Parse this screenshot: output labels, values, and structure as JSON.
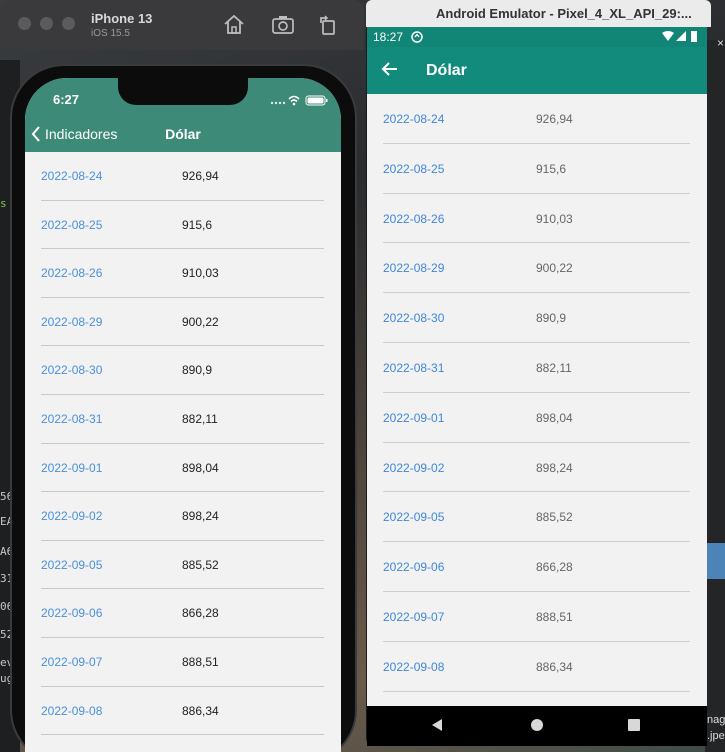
{
  "ios": {
    "device_name": "iPhone 13",
    "os_version": "iOS 15.5",
    "time": "6:27",
    "back_label": "Indicadores",
    "title": "Dólar",
    "rows": [
      {
        "date": "2022-08-24",
        "value": "926,94"
      },
      {
        "date": "2022-08-25",
        "value": "915,6"
      },
      {
        "date": "2022-08-26",
        "value": "910,03"
      },
      {
        "date": "2022-08-29",
        "value": "900,22"
      },
      {
        "date": "2022-08-30",
        "value": "890,9"
      },
      {
        "date": "2022-08-31",
        "value": "882,11"
      },
      {
        "date": "2022-09-01",
        "value": "898,04"
      },
      {
        "date": "2022-09-02",
        "value": "898,24"
      },
      {
        "date": "2022-09-05",
        "value": "885,52"
      },
      {
        "date": "2022-09-06",
        "value": "866,28"
      },
      {
        "date": "2022-09-07",
        "value": "888,51"
      },
      {
        "date": "2022-09-08",
        "value": "886,34"
      }
    ]
  },
  "android": {
    "window_title": "Android Emulator - Pixel_4_XL_API_29:...",
    "time": "18:27",
    "title": "Dólar",
    "rows": [
      {
        "date": "2022-08-24",
        "value": "926,94"
      },
      {
        "date": "2022-08-25",
        "value": "915,6"
      },
      {
        "date": "2022-08-26",
        "value": "910,03"
      },
      {
        "date": "2022-08-29",
        "value": "900,22"
      },
      {
        "date": "2022-08-30",
        "value": "890,9"
      },
      {
        "date": "2022-08-31",
        "value": "882,11"
      },
      {
        "date": "2022-09-01",
        "value": "898,04"
      },
      {
        "date": "2022-09-02",
        "value": "898,24"
      },
      {
        "date": "2022-09-05",
        "value": "885,52"
      },
      {
        "date": "2022-09-06",
        "value": "866,28"
      },
      {
        "date": "2022-09-07",
        "value": "888,51"
      },
      {
        "date": "2022-09-08",
        "value": "886,34"
      }
    ]
  },
  "desktop": {
    "left_snippets": [
      "s",
      "56",
      "EA",
      "A6",
      "31",
      "06",
      "52",
      "ev",
      "ug"
    ],
    "right_snippets": [
      "nag",
      ".jpe"
    ],
    "close_glyph": "×"
  },
  "colors": {
    "ios_header": "#3e8a79",
    "android_appbar": "#138b7c",
    "android_statusbar": "#118676",
    "link_blue": "#4a90d9"
  },
  "icons": [
    "home-icon",
    "screenshot-icon",
    "rotate-icon",
    "chevron-left-icon",
    "arrow-back-icon",
    "wifi-icon",
    "battery-icon",
    "nav-back-icon",
    "nav-home-icon",
    "nav-recents-icon"
  ]
}
